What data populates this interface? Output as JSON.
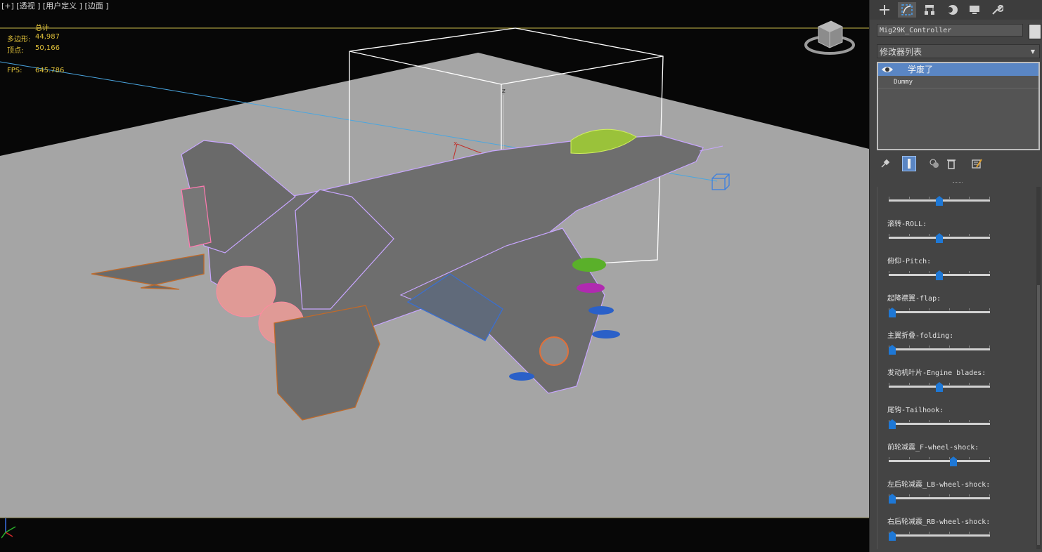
{
  "viewport": {
    "label": "[+] [透视 ] [用户定义 ] [边面 ]",
    "stats": {
      "total_label": "总计",
      "polygons_label": "多边形:",
      "polygons_value": "44,987",
      "vertices_label": "顶点:",
      "vertices_value": "50,166",
      "fps_label": "FPS:",
      "fps_value": "645.786"
    }
  },
  "command_panel": {
    "tabs": [
      {
        "icon": "plus-icon",
        "label": "Create"
      },
      {
        "icon": "modify-icon",
        "label": "Modify"
      },
      {
        "icon": "hierarchy-icon",
        "label": "Hierarchy"
      },
      {
        "icon": "motion-icon",
        "label": "Motion"
      },
      {
        "icon": "display-icon",
        "label": "Display"
      },
      {
        "icon": "utilities-icon",
        "label": "Utilities"
      }
    ],
    "active_tab": "Modify",
    "object_name": "Mig29K_Controller",
    "modifier_list_label": "修改器列表",
    "stack": [
      {
        "label": "学废了",
        "selected": true
      },
      {
        "label": "Dummy",
        "selected": false
      }
    ],
    "parameters": [
      {
        "label": "",
        "value": 0.5
      },
      {
        "label": "滚转-ROLL:",
        "value": 0.5
      },
      {
        "label": "俯仰-Pitch:",
        "value": 0.5
      },
      {
        "label": "起降襟翼-flap:",
        "value": 0.0
      },
      {
        "label": "主翼折叠-folding:",
        "value": 0.0
      },
      {
        "label": "发动机叶片-Engine blades:",
        "value": 0.5
      },
      {
        "label": "尾钩-Tailhook:",
        "value": 0.0
      },
      {
        "label": "前轮减震_F-wheel-shock:",
        "value": 0.65
      },
      {
        "label": "左后轮减震_LB-wheel-shock:",
        "value": 0.0
      },
      {
        "label": "右后轮减震_RB-wheel-shock:",
        "value": 0.0
      }
    ]
  },
  "colors": {
    "accent": "#1e78d6",
    "selected": "#5a86c4",
    "ground": "#a5a5a5",
    "wire": "#c8a6ff"
  }
}
